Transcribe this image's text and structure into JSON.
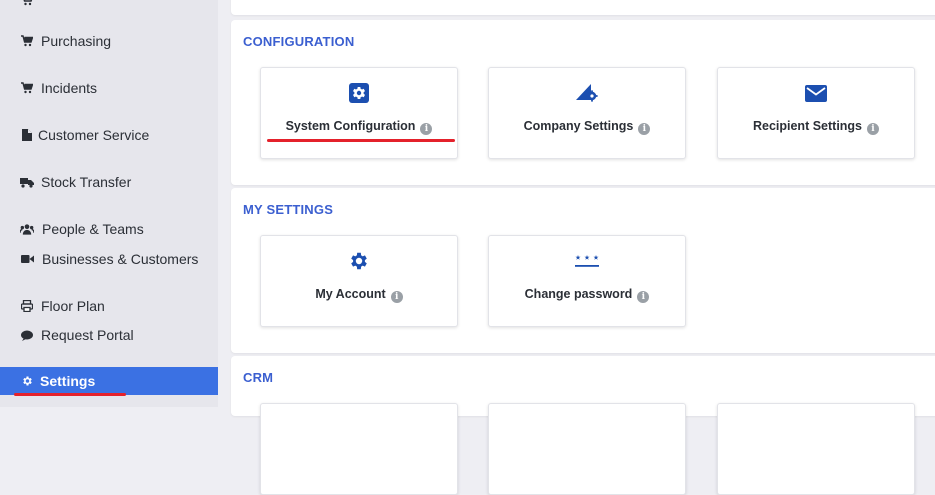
{
  "sidebar": {
    "items": [
      {
        "label": "Purchasing",
        "icon": "cart-icon"
      },
      {
        "label": "Incidents",
        "icon": "cart-icon"
      },
      {
        "label": "Customer Service",
        "icon": "document-icon"
      },
      {
        "label": "Stock Transfer",
        "icon": "truck-icon"
      },
      {
        "label": "People & Teams",
        "icon": "users-icon"
      },
      {
        "label": "Businesses & Customers",
        "icon": "video-icon"
      },
      {
        "label": "Floor Plan",
        "icon": "printer-icon"
      },
      {
        "label": "Request Portal",
        "icon": "chat-icon"
      },
      {
        "label": "Settings",
        "icon": "gear-icon",
        "active": true
      }
    ]
  },
  "sections": {
    "configuration": {
      "title": "CONFIGURATION",
      "cards": [
        {
          "label": "System Configuration",
          "icon": "gear-square-icon"
        },
        {
          "label": "Company Settings",
          "icon": "company-settings-icon"
        },
        {
          "label": "Recipient Settings",
          "icon": "envelope-icon"
        }
      ]
    },
    "my_settings": {
      "title": "MY SETTINGS",
      "cards": [
        {
          "label": "My Account",
          "icon": "gear-icon"
        },
        {
          "label": "Change password",
          "icon": "password-icon"
        }
      ]
    },
    "crm": {
      "title": "CRM"
    }
  },
  "info_glyph": "i",
  "colors": {
    "accent": "#3b71e3",
    "icon": "#1c4fb0",
    "section_title": "#3b5fd0",
    "highlight": "#e4212b"
  }
}
